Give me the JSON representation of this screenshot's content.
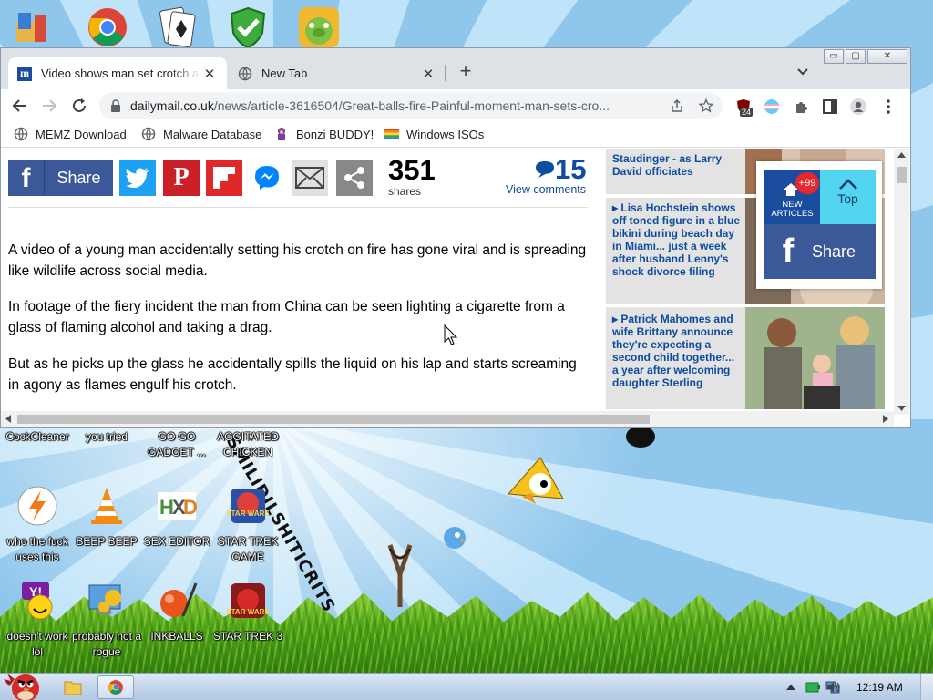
{
  "desktop": {
    "deco_text": "SMILIDILSHITICRITS",
    "icons": [
      {
        "label": "CockCleaner"
      },
      {
        "label": "you tried"
      },
      {
        "label": "GO GO GADGET ..."
      },
      {
        "label": "AGGITATED CHICKEN"
      },
      {
        "label": "who the fuck uses this"
      },
      {
        "label": "BEEP BEEP"
      },
      {
        "label": "SEX EDITOR"
      },
      {
        "label": "STAR TREK GAME"
      },
      {
        "label": "doesn't work lol"
      },
      {
        "label": "probably not a rogue"
      },
      {
        "label": "INKBALLS"
      },
      {
        "label": "STAR TREK 3"
      }
    ]
  },
  "browser": {
    "tabs": [
      {
        "title": "Video shows man set crotch ablaze",
        "favicon": "dailymail-icon"
      },
      {
        "title": "New Tab",
        "favicon": "globe-icon"
      }
    ],
    "window_buttons": {
      "minimize": "▭",
      "maximize": "▢",
      "close": "✕"
    },
    "url": {
      "domain": "dailymail.co.uk",
      "path": "/news/article-3616504/Great-balls-fire-Painful-moment-man-sets-cro..."
    },
    "extension_badge": "24",
    "bookmarks": [
      {
        "label": "MEMZ Download",
        "icon": "globe-icon"
      },
      {
        "label": "Malware Database",
        "icon": "globe-icon"
      },
      {
        "label": "Bonzi BUDDY!",
        "icon": "bonzi-icon"
      },
      {
        "label": "Windows ISOs",
        "icon": "windows-flag-icon"
      }
    ]
  },
  "article": {
    "share_label": "Share",
    "shares_count": "351",
    "shares_label": "shares",
    "comments_count": "15",
    "comments_label": "View comments",
    "paragraphs": [
      "A video of a young man accidentally setting his crotch on fire has gone viral and is spreading like wildlife across social media.",
      "In footage of the fiery incident the man from China can be seen lighting a cigarette from a glass of flaming alcohol and taking a drag.",
      "But as he picks up the glass he accidentally spills the liquid on his lap and starts screaming in agony as flames engulf his crotch."
    ],
    "colors": {
      "facebook": "#3b5998",
      "twitter": "#1da1f2",
      "pinterest": "#cb2027",
      "flipboard": "#e12828",
      "link_blue": "#0e4ca1"
    }
  },
  "sidebar": {
    "items": [
      {
        "headline": "Staudinger - as Larry David officiates"
      },
      {
        "headline": "Lisa Hochstein shows off toned figure in a blue bikini during beach day in Miami... just a week after husband Lenny's shock divorce filing"
      },
      {
        "headline": "Patrick Mahomes and wife Brittany announce they're expecting a second child together... a year after welcoming daughter Sterling"
      }
    ],
    "float": {
      "new_count": "+99",
      "new_label": "NEW ARTICLES",
      "top_label": "Top",
      "share_label": "Share"
    }
  },
  "taskbar": {
    "clock": "12:19 AM"
  }
}
